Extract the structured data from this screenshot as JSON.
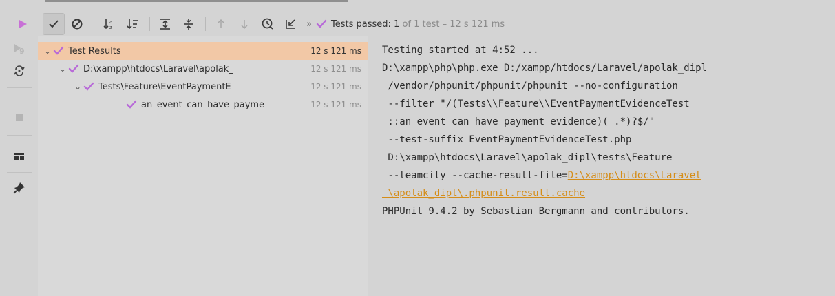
{
  "toolbar": {
    "status_prefix": "Tests passed:",
    "status_count": "1",
    "status_rest": "of 1 test – 12 s 121 ms",
    "double_chevron": "»"
  },
  "tree": {
    "rows": [
      {
        "label": "Test Results",
        "time": "12 s 121 ms"
      },
      {
        "label": "D:\\xampp\\htdocs\\Laravel\\apolak_",
        "time": "12 s 121 ms"
      },
      {
        "label": "Tests\\Feature\\EventPaymentE",
        "time": "12 s 121 ms"
      },
      {
        "label": "an_event_can_have_payme",
        "time": "12 s 121 ms"
      }
    ]
  },
  "console": {
    "lines": [
      "Testing started at 4:52 ...",
      "D:\\xampp\\php\\php.exe D:/xampp/htdocs/Laravel/apolak_dipl",
      " /vendor/phpunit/phpunit/phpunit --no-configuration",
      " --filter \"/(Tests\\\\Feature\\\\EventPaymentEvidenceTest",
      " ::an_event_can_have_payment_evidence)( .*)?$/\"",
      " --test-suffix EventPaymentEvidenceTest.php",
      " D:\\xampp\\htdocs\\Laravel\\apolak_dipl\\tests\\Feature",
      " --teamcity --cache-result-file=",
      "D:\\xampp\\htdocs\\Laravel",
      " \\apolak_dipl\\.phpunit.result.cache",
      "PHPUnit 9.4.2 by Sebastian Bergmann and contributors."
    ]
  },
  "colors": {
    "check": "#b86ad8",
    "run": "#c870d6",
    "link": "#d58d18",
    "selected_row": "#f2c8a6"
  },
  "icons": {
    "run": "play-icon",
    "passed_filter": "checkmark-icon",
    "ignored_filter": "cancel-icon",
    "sort_alpha": "sort-alphabetically-icon",
    "sort_duration": "sort-duration-icon",
    "expand_all": "expand-all-icon",
    "collapse_all": "collapse-all-icon",
    "prev": "arrow-up-icon",
    "next": "arrow-down-icon",
    "history": "clock-icon",
    "import": "import-icon"
  }
}
